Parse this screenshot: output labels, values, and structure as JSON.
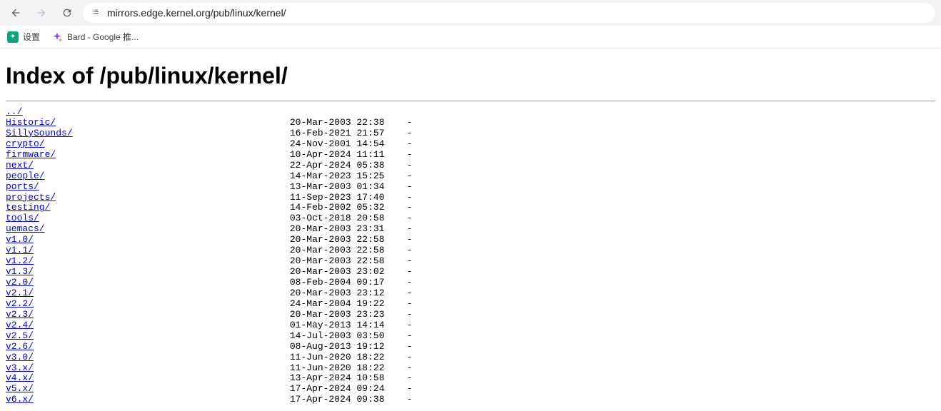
{
  "browser": {
    "url": "mirrors.edge.kernel.org/pub/linux/kernel/"
  },
  "bookmarks": [
    {
      "label": "设置",
      "icon": "green"
    },
    {
      "label": "Bard - Google 推...",
      "icon": "bard"
    }
  ],
  "page": {
    "title": "Index of /pub/linux/kernel/"
  },
  "listing": [
    {
      "name": "../",
      "date": "",
      "size": ""
    },
    {
      "name": "Historic/",
      "date": "20-Mar-2003 22:38",
      "size": "-"
    },
    {
      "name": "SillySounds/",
      "date": "16-Feb-2021 21:57",
      "size": "-"
    },
    {
      "name": "crypto/",
      "date": "24-Nov-2001 14:54",
      "size": "-"
    },
    {
      "name": "firmware/",
      "date": "10-Apr-2024 11:11",
      "size": "-"
    },
    {
      "name": "next/",
      "date": "22-Apr-2024 05:38",
      "size": "-"
    },
    {
      "name": "people/",
      "date": "14-Mar-2023 15:25",
      "size": "-"
    },
    {
      "name": "ports/",
      "date": "13-Mar-2003 01:34",
      "size": "-"
    },
    {
      "name": "projects/",
      "date": "11-Sep-2023 17:40",
      "size": "-"
    },
    {
      "name": "testing/",
      "date": "14-Feb-2002 05:32",
      "size": "-"
    },
    {
      "name": "tools/",
      "date": "03-Oct-2018 20:58",
      "size": "-"
    },
    {
      "name": "uemacs/",
      "date": "20-Mar-2003 23:31",
      "size": "-"
    },
    {
      "name": "v1.0/",
      "date": "20-Mar-2003 22:58",
      "size": "-"
    },
    {
      "name": "v1.1/",
      "date": "20-Mar-2003 22:58",
      "size": "-"
    },
    {
      "name": "v1.2/",
      "date": "20-Mar-2003 22:58",
      "size": "-"
    },
    {
      "name": "v1.3/",
      "date": "20-Mar-2003 23:02",
      "size": "-"
    },
    {
      "name": "v2.0/",
      "date": "08-Feb-2004 09:17",
      "size": "-"
    },
    {
      "name": "v2.1/",
      "date": "20-Mar-2003 23:12",
      "size": "-"
    },
    {
      "name": "v2.2/",
      "date": "24-Mar-2004 19:22",
      "size": "-"
    },
    {
      "name": "v2.3/",
      "date": "20-Mar-2003 23:23",
      "size": "-"
    },
    {
      "name": "v2.4/",
      "date": "01-May-2013 14:14",
      "size": "-"
    },
    {
      "name": "v2.5/",
      "date": "14-Jul-2003 03:50",
      "size": "-"
    },
    {
      "name": "v2.6/",
      "date": "08-Aug-2013 19:12",
      "size": "-"
    },
    {
      "name": "v3.0/",
      "date": "11-Jun-2020 18:22",
      "size": "-"
    },
    {
      "name": "v3.x/",
      "date": "11-Jun-2020 18:22",
      "size": "-"
    },
    {
      "name": "v4.x/",
      "date": "13-Apr-2024 10:58",
      "size": "-"
    },
    {
      "name": "v5.x/",
      "date": "17-Apr-2024 09:24",
      "size": "-"
    },
    {
      "name": "v6.x/",
      "date": "17-Apr-2024 09:38",
      "size": "-"
    }
  ]
}
